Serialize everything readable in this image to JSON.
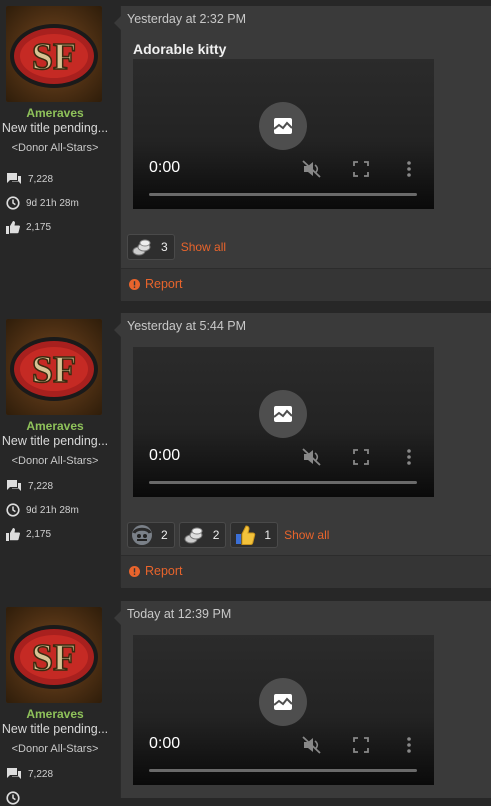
{
  "colors": {
    "username": "#8fc25a",
    "accent": "#e8642c",
    "panel": "#3a3a3a",
    "background": "#272727"
  },
  "posts": [
    {
      "user": {
        "name": "Ameraves",
        "title": "New title pending...",
        "banner": "<Donor All-Stars>",
        "messages": "7,228",
        "time_online": "9d 21h 28m",
        "likes": "2,175"
      },
      "timestamp": "Yesterday at 2:32 PM",
      "thread_title": "Adorable kitty",
      "video": {
        "time": "0:00"
      },
      "reactions": [
        {
          "icon": "silver-coins-icon",
          "count": "3"
        }
      ],
      "show_all": "Show all",
      "report": "Report"
    },
    {
      "user": {
        "name": "Ameraves",
        "title": "New title pending...",
        "banner": "<Donor All-Stars>",
        "messages": "7,228",
        "time_online": "9d 21h 28m",
        "likes": "2,175"
      },
      "timestamp": "Yesterday at 5:44 PM",
      "thread_title": "",
      "video": {
        "time": "0:00"
      },
      "reactions": [
        {
          "icon": "helmet-face-icon",
          "count": "2"
        },
        {
          "icon": "silver-coins-icon",
          "count": "2"
        },
        {
          "icon": "thumbs-up-icon",
          "count": "1"
        }
      ],
      "show_all": "Show all",
      "report": "Report"
    },
    {
      "user": {
        "name": "Ameraves",
        "title": "New title pending...",
        "banner": "<Donor All-Stars>",
        "messages": "7,228"
      },
      "timestamp": "Today at 12:39 PM",
      "thread_title": "",
      "video": {
        "time": "0:00"
      }
    }
  ]
}
